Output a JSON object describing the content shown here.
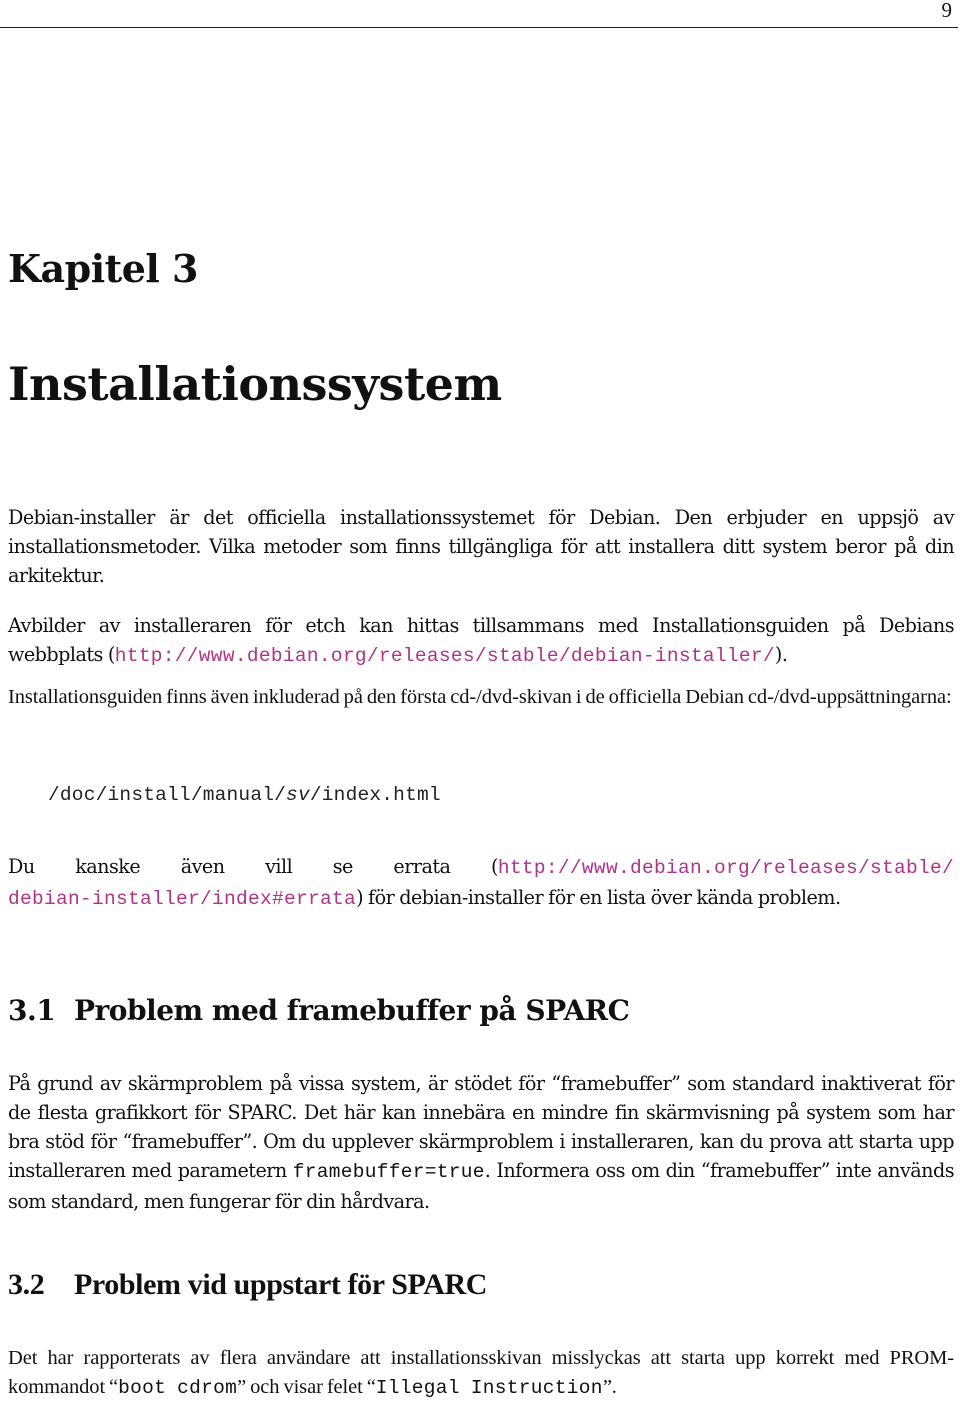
{
  "header": {
    "page_number": "9"
  },
  "chapter": {
    "label": "Kapitel 3",
    "title": "Installationssystem"
  },
  "intro": {
    "p1": "Debian-installer är det officiella installationssystemet för Debian. Den erbjuder en uppsjö av installationsmetoder. Vilka metoder som finns tillgängliga för att installera ditt system beror på din arkitektur.",
    "p2_before": "Avbilder av installeraren för etch kan hittas tillsammans med Installationsguiden på Debians webbplats (",
    "p2_link": "http://www.debian.org/releases/stable/debian-installer/",
    "p2_after": ").",
    "p3": "Installationsguiden finns även inkluderad på den första cd-/dvd-skivan i de officiella Debian cd-/dvd-uppsättningarna:",
    "code_path_before": "/doc/install/manual/",
    "code_path_lang": "sv",
    "code_path_after": "/index.html",
    "p4_before": "Du kanske även vill se errata (",
    "p4_link_line1": "http://www.debian.org/releases/stable/",
    "p4_link_line2": "debian-installer/index#errata",
    "p4_after": ") för debian-installer för en lista över kända problem."
  },
  "sections": [
    {
      "number": "3.1",
      "title": "Problem med framebuffer på SPARC",
      "text_1": "På grund av skärmproblem på vissa system, är stödet för “framebuffer” som standard inaktiverat för de flesta grafikkort för SPARC. Det här kan innebära en mindre fin skärmvisning på system som har bra stöd för “framebuffer”. Om du upplever skärmproblem i installeraren, kan du prova att starta upp installeraren med parametern ",
      "code": "framebuffer=true",
      "text_2": ". Informera oss om din “framebuffer” inte används som standard, men fungerar för din hårdvara."
    },
    {
      "number": "3.2",
      "title": "Problem vid uppstart för SPARC",
      "text_1": "Det har rapporterats av flera användare att installationsskivan misslyckas att starta upp korrekt med PROM-kommandot “",
      "code_1": "boot cdrom",
      "text_2": "” och visar felet “",
      "code_2": "Illegal Instruction",
      "text_3": "”."
    }
  ],
  "colors": {
    "link": "#b0338a",
    "text": "#111111"
  }
}
